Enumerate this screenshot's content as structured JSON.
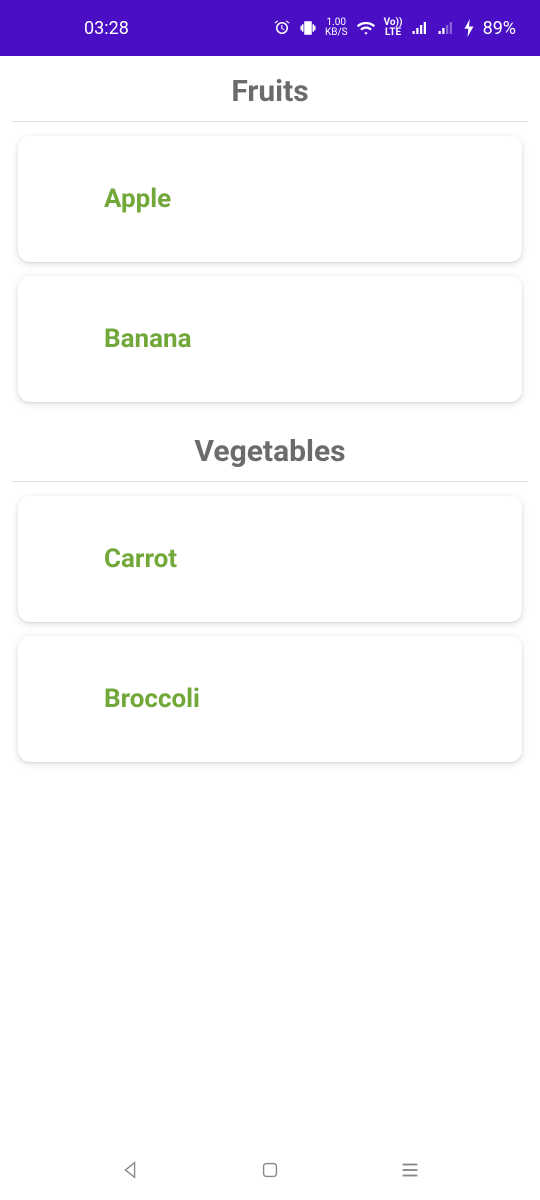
{
  "status": {
    "time": "03:28",
    "data_rate": "1.00",
    "data_unit": "KB/S",
    "volte_top": "Vo))",
    "volte_bot": "LTE",
    "battery": "89%"
  },
  "sections": [
    {
      "title": "Fruits",
      "items": [
        "Apple",
        "Banana"
      ]
    },
    {
      "title": "Vegetables",
      "items": [
        "Carrot",
        "Broccoli"
      ]
    }
  ]
}
